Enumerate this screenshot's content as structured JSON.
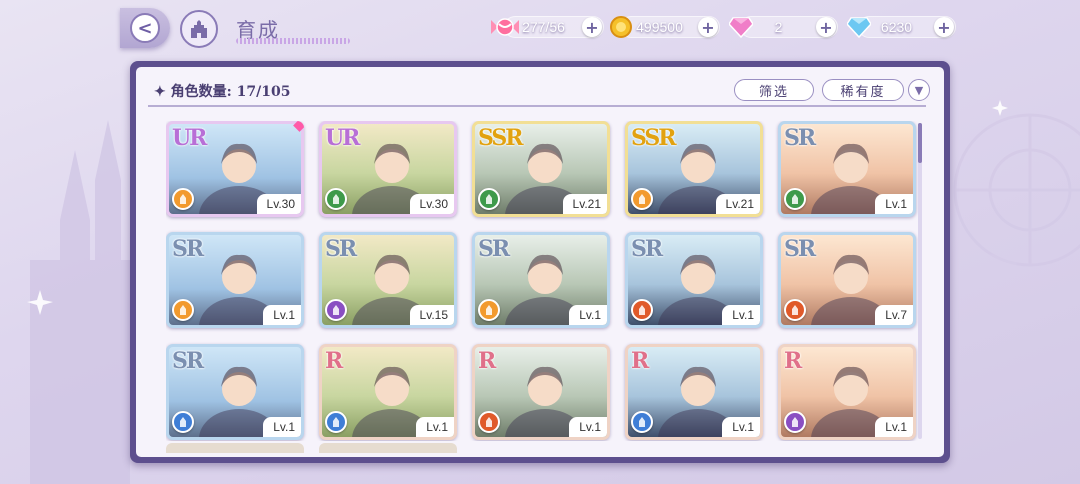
{
  "header": {
    "title": "育成",
    "back_label": "<",
    "resources": [
      {
        "name": "stamina",
        "icon": "candy-icon",
        "value": "277/56"
      },
      {
        "name": "gold",
        "icon": "gold-coin-icon",
        "value": "499500"
      },
      {
        "name": "pink-gem",
        "icon": "pink-diamond-icon",
        "value": "2"
      },
      {
        "name": "blue-gem",
        "icon": "blue-diamond-icon",
        "value": "6230"
      }
    ],
    "plus_label": "+"
  },
  "panel": {
    "count_label": "✦ 角色数量: 17/105",
    "filter_label": "筛选",
    "rarity_sort_label": "稀有度",
    "sort_toggle_label": "▼"
  },
  "colors": {
    "orange": "#f29a2e",
    "green": "#3e9a4a",
    "purple": "#8a4fc2",
    "red": "#e05a2a",
    "blue": "#3f7ed6",
    "ur_frame": "#e7c8f0",
    "ssr_frame": "#f2df95",
    "sr_frame": "#b9d6ee",
    "r_frame": "#efd3c5"
  },
  "cards": [
    {
      "rarity": "UR",
      "level": "Lv.30",
      "element": "orange",
      "new": true
    },
    {
      "rarity": "UR",
      "level": "Lv.30",
      "element": "green",
      "new": false
    },
    {
      "rarity": "SSR",
      "level": "Lv.21",
      "element": "green",
      "new": false
    },
    {
      "rarity": "SSR",
      "level": "Lv.21",
      "element": "orange",
      "new": false
    },
    {
      "rarity": "SR",
      "level": "Lv.1",
      "element": "green",
      "new": false
    },
    {
      "rarity": "SR",
      "level": "Lv.1",
      "element": "orange",
      "new": false
    },
    {
      "rarity": "SR",
      "level": "Lv.15",
      "element": "purple",
      "new": false
    },
    {
      "rarity": "SR",
      "level": "Lv.1",
      "element": "orange",
      "new": false
    },
    {
      "rarity": "SR",
      "level": "Lv.1",
      "element": "red",
      "new": false
    },
    {
      "rarity": "SR",
      "level": "Lv.7",
      "element": "red",
      "new": false
    },
    {
      "rarity": "SR",
      "level": "Lv.1",
      "element": "blue",
      "new": false
    },
    {
      "rarity": "R",
      "level": "Lv.1",
      "element": "blue",
      "new": false
    },
    {
      "rarity": "R",
      "level": "Lv.1",
      "element": "red",
      "new": false
    },
    {
      "rarity": "R",
      "level": "Lv.1",
      "element": "blue",
      "new": false
    },
    {
      "rarity": "R",
      "level": "Lv.1",
      "element": "purple",
      "new": false
    }
  ]
}
